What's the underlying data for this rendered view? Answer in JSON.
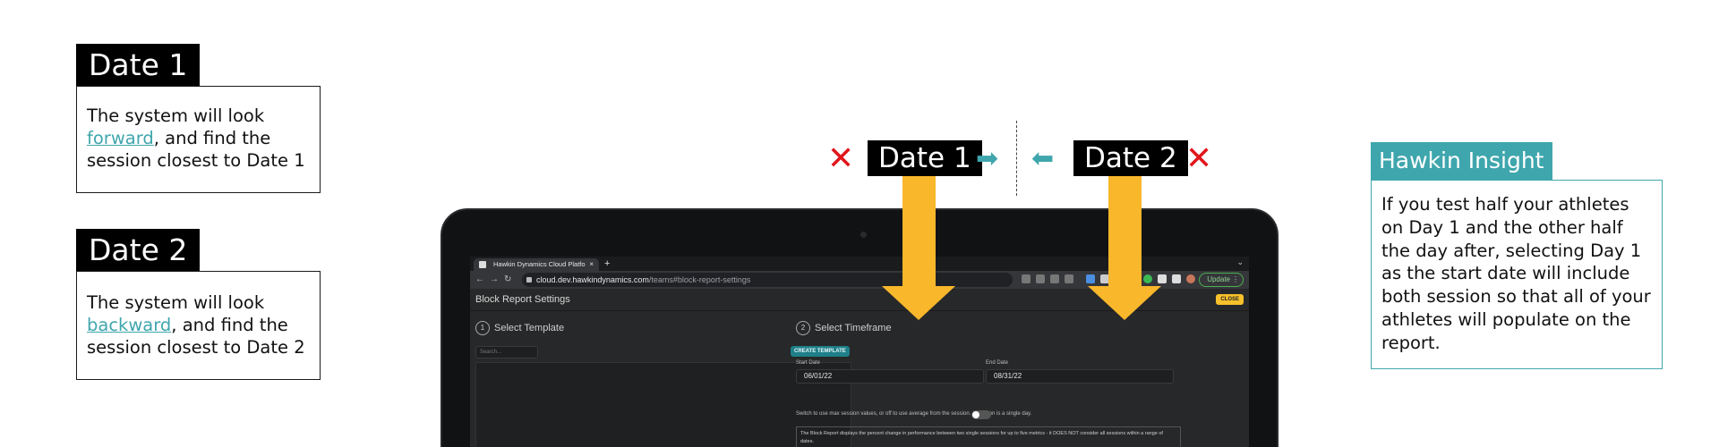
{
  "left": {
    "date1": {
      "label": "Date 1",
      "text_before": "The system will look ",
      "link": "forward",
      "text_after": ", and find the session closest to Date 1"
    },
    "date2": {
      "label": "Date 2",
      "text_before": "The system will look ",
      "link": "backward",
      "text_after": ", and find the session closest to Date 2"
    }
  },
  "timeline": {
    "date1_label": "Date 1",
    "date2_label": "Date 2",
    "x_glyph": "✕",
    "arrow_right": "➡",
    "arrow_left": "⬅"
  },
  "browser": {
    "tab_title": "Hawkin Dynamics Cloud Platfo",
    "tab_close": "×",
    "new_tab": "+",
    "chevron": "⌄",
    "url_host": "cloud.dev.hawkindynamics.com",
    "url_path": "/teams#block-report-settings",
    "update_label": "Update",
    "update_dots": "⋮",
    "icons": [
      "back-icon",
      "forward-icon",
      "reload-icon",
      "lock-icon",
      "key-icon",
      "zoom-icon",
      "share-icon",
      "star-icon",
      "extension-icon",
      "puzzle-icon",
      "sidebar-icon",
      "profile-avatar"
    ]
  },
  "app": {
    "title": "Block Report Settings",
    "close_label": "CLOSE",
    "step1": {
      "num": "1",
      "label": "Select Template"
    },
    "step2": {
      "num": "2",
      "label": "Select Timeframe"
    },
    "search_placeholder": "Search...",
    "create_label": "CREATE TEMPLATE",
    "start_label": "Start Date",
    "start_value": "06/01/22",
    "end_label": "End Date",
    "end_value": "08/31/22",
    "switch_text": "Switch to use max session values, or off to use average from the session. A session is a single day.",
    "description": "The Block Report displays the percent change in performance between two single sessions for up to five metrics - it DOES NOT consider all sessions within a range of dates."
  },
  "insight": {
    "title": "Hawkin Insight",
    "body": "If you test half your athletes on Day 1 and the other half the day after, selecting Day 1 as the start date will include both session so that all of your athletes will populate on the report."
  },
  "colors": {
    "accent_teal": "#3fa6ad",
    "arrow_yellow": "#f9b72b",
    "x_red": "#e0161b",
    "close_yellow": "#f7c12c"
  }
}
